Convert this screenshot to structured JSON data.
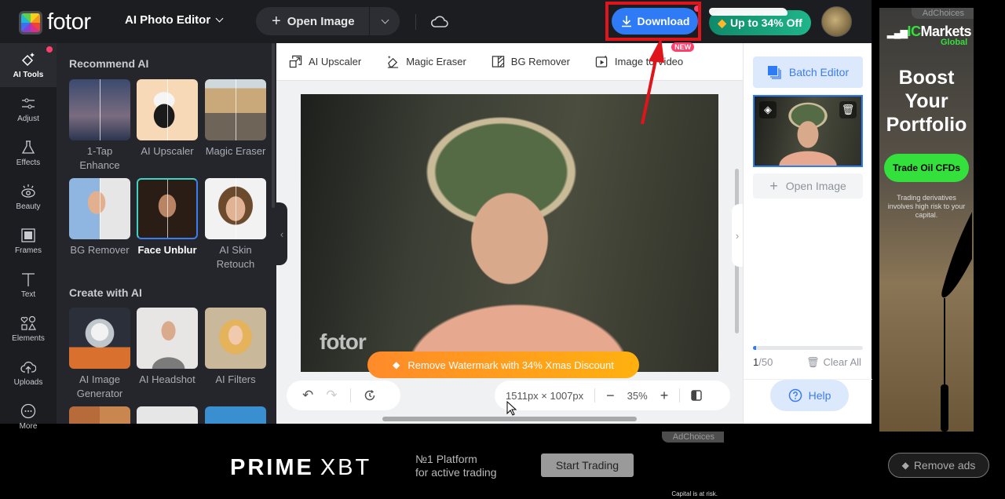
{
  "header": {
    "logo_text": "fotor",
    "product_menu": "AI Photo Editor",
    "open_image": "Open Image",
    "download": "Download",
    "promo": "Up to 34% Off"
  },
  "left_nav": [
    {
      "label": "AI Tools",
      "icon": "sparkle-icon",
      "active": true
    },
    {
      "label": "Adjust",
      "icon": "sliders-icon"
    },
    {
      "label": "Effects",
      "icon": "flask-icon"
    },
    {
      "label": "Beauty",
      "icon": "eye-icon"
    },
    {
      "label": "Frames",
      "icon": "frame-icon"
    },
    {
      "label": "Text",
      "icon": "text-icon"
    },
    {
      "label": "Elements",
      "icon": "shapes-icon"
    },
    {
      "label": "Uploads",
      "icon": "cloud-upload-icon"
    },
    {
      "label": "More",
      "icon": "more-icon"
    }
  ],
  "panel": {
    "recommend_title": "Recommend AI",
    "recommend": [
      {
        "label": "1-Tap Enhance"
      },
      {
        "label": "AI Upscaler"
      },
      {
        "label": "Magic Eraser"
      },
      {
        "label": "BG Remover"
      },
      {
        "label": "Face Unblur",
        "selected": true
      },
      {
        "label": "AI Skin Retouch"
      }
    ],
    "create_title": "Create with AI",
    "create": [
      {
        "label": "AI Image Generator"
      },
      {
        "label": "AI Headshot"
      },
      {
        "label": "AI Filters"
      }
    ]
  },
  "toolstrip": [
    {
      "label": "AI Upscaler",
      "icon": "upscale-icon"
    },
    {
      "label": "Magic Eraser",
      "icon": "eraser-icon"
    },
    {
      "label": "BG Remover",
      "icon": "bg-remover-icon"
    },
    {
      "label": "Image to Video",
      "icon": "video-icon",
      "badge": "NEW"
    }
  ],
  "canvas": {
    "watermark": "fotor",
    "watermark_banner": "Remove Watermark with 34% Xmas Discount",
    "dimensions": "1511px × 1007px",
    "zoom": "35%"
  },
  "right_panel": {
    "batch_editor": "Batch Editor",
    "open_image": "Open Image",
    "count_current": "1",
    "count_total": "/50",
    "progress_fraction": 0.02,
    "clear_all": "Clear All",
    "help": "Help"
  },
  "ads": {
    "adchoices": "AdChoices",
    "side": {
      "brand": "IC",
      "brand_rest": "Markets",
      "brand_sub": "Global",
      "headline": "Boost Your Portfolio",
      "cta": "Trade Oil CFDs",
      "disclaimer": "Trading derivatives involves high risk to your capital."
    },
    "bottom": {
      "brand": "PRIME",
      "brand2": "XBT",
      "tagline1": "№1 Platform",
      "tagline2": "for active trading",
      "cta": "Start Trading",
      "disclaimer": "Capital is at risk."
    },
    "remove_ads": "Remove ads"
  }
}
